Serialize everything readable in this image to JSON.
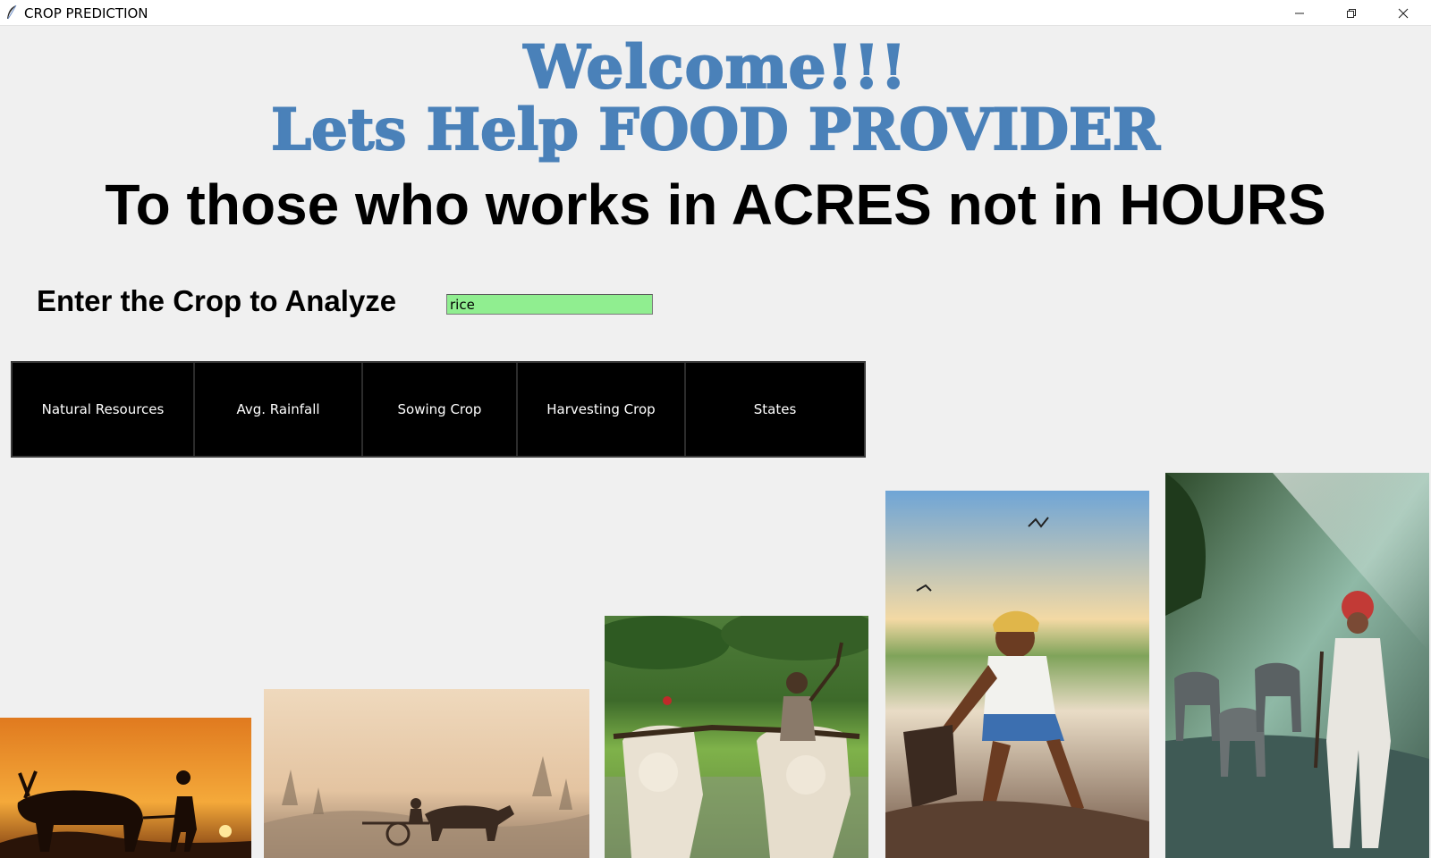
{
  "window": {
    "title": "CROP PREDICTION",
    "controls": [
      "minimize-icon",
      "restore-icon",
      "close-icon"
    ]
  },
  "headings": {
    "welcome": "Welcome!!!",
    "help": "Lets Help FOOD PROVIDER",
    "tagline": "To those who works in ACRES not in HOURS"
  },
  "crop_input": {
    "label": "Enter the Crop to Analyze",
    "value": "rice"
  },
  "nav_buttons": [
    {
      "label": "Natural Resources"
    },
    {
      "label": "Avg. Rainfall"
    },
    {
      "label": "Sowing Crop"
    },
    {
      "label": "Harvesting Crop"
    },
    {
      "label": "States"
    }
  ],
  "colors": {
    "heading_blue": "#4a81b9",
    "input_bg": "#90ee90",
    "button_bg": "#000000",
    "button_text": "#ffffff",
    "window_bg": "#f0f0f0"
  }
}
